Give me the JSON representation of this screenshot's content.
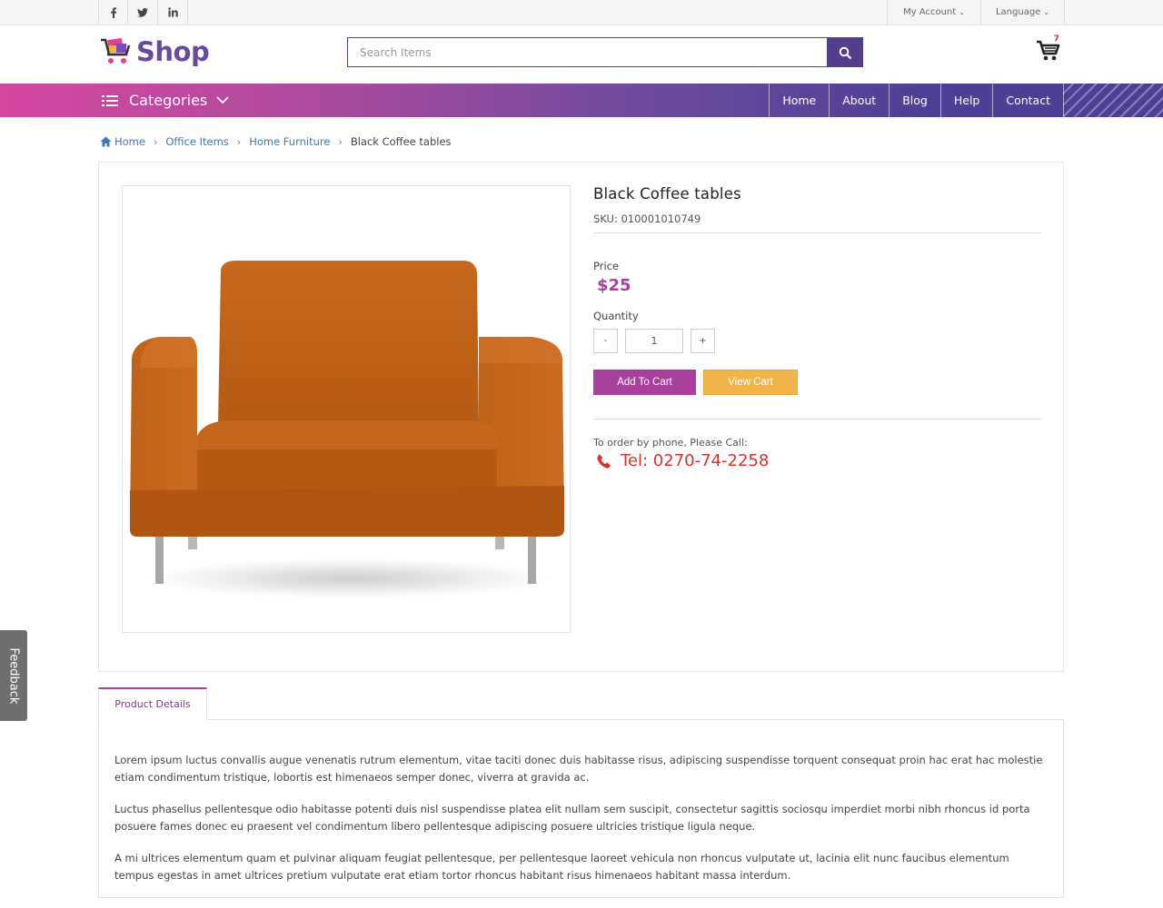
{
  "topbar": {
    "social": [
      {
        "icon": "facebook-icon",
        "glyph": "f"
      },
      {
        "icon": "twitter-icon",
        "glyph": "🐦"
      },
      {
        "icon": "linkedin-icon",
        "glyph": "in"
      }
    ],
    "account_label": "My Account",
    "language_label": "Language"
  },
  "header": {
    "logo_text": "Shop",
    "search_placeholder": "Search Items",
    "cart_count": "7"
  },
  "nav": {
    "categories_label": "Categories",
    "menu": [
      "Home",
      "About",
      "Blog",
      "Help",
      "Contact"
    ]
  },
  "breadcrumb": {
    "items": [
      "Home",
      "Office Items",
      "Home Furniture"
    ],
    "current": "Black Coffee tables"
  },
  "product": {
    "title": "Black Coffee tables",
    "sku": "SKU: 010001010749",
    "price_label": "Price",
    "price": "$25",
    "quantity_label": "Quantity",
    "quantity_minus": "-",
    "quantity_value": "1",
    "quantity_plus": "+",
    "add_to_cart": "Add To Cart",
    "view_cart": "View Cart",
    "phone_label": "To order by phone, Please Call:",
    "phone": "Tel: 0270-74-2258"
  },
  "tabs": {
    "product_details": "Product Details"
  },
  "details": {
    "paragraphs": [
      "Lorem ipsum luctus convallis augue venenatis rutrum elementum, vitae taciti donec duis habitasse risus, adipiscing suspendisse torquent consequat proin hac erat hac molestie etiam condimentum tristique, lobortis est himenaeos semper donec, viverra at gravida ac.",
      "Luctus phasellus pellentesque odio habitasse potenti duis nisl suspendisse platea elit nullam sem suscipit, consectetur sagittis sociosqu imperdiet morbi nibh rhoncus id porta posuere fames donec eu praesent vel condimentum libero pellentesque adipiscing posuere ultricies tristique ligula neque.",
      "A mi ultrices elementum quam et pulvinar aliquam feugiat pellentesque, per pellentesque laoreet vehicula non rhoncus vulputate ut, lacinia elit nunc faucibus elementum tempus egestas in amet ultrices pretium vulputate erat etiam tortor rhoncus habitant risus himenaeos habitant massa interdum."
    ]
  },
  "feedback_label": "Feedback",
  "colors": {
    "brand_purple": "#553d8d",
    "accent_magenta": "#a9409c",
    "view_cart_orange": "#f0b44a",
    "phone_red": "#d9342b",
    "link_blue": "#3f7ab4"
  }
}
